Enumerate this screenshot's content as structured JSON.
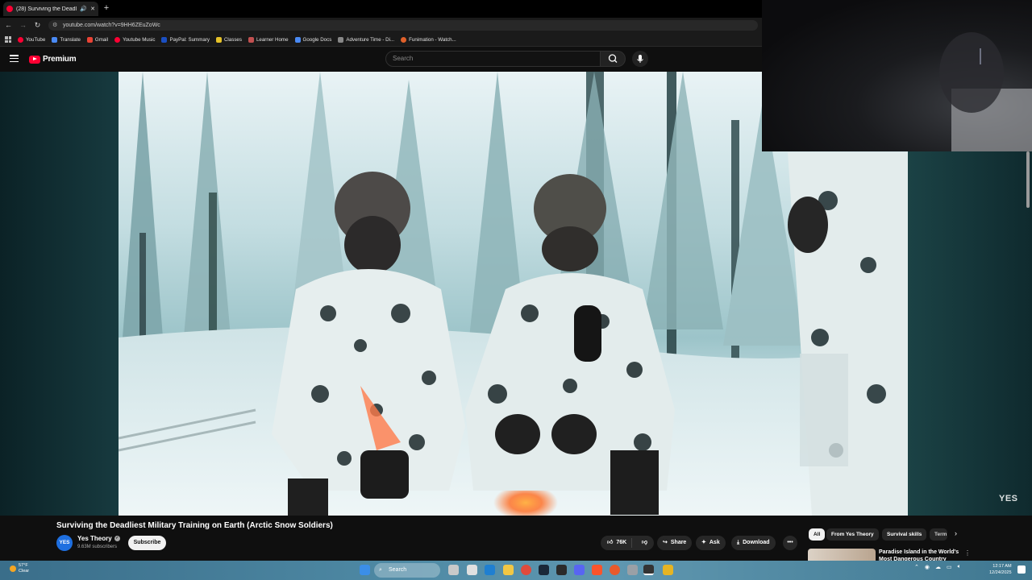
{
  "browser": {
    "tab_title": "(28) Surviving the Deadliest",
    "url": "youtube.com/watch?v=9HH6ZEuZoWc",
    "bookmarks": [
      {
        "label": "YouTube",
        "color": "#ff0033"
      },
      {
        "label": "Translate",
        "color": "#4a8af4"
      },
      {
        "label": "Gmail",
        "color": "#ea4335"
      },
      {
        "label": "Youtube Music",
        "color": "#ff0033"
      },
      {
        "label": "PayPal: Summary",
        "color": "#1b4fc2"
      },
      {
        "label": "Classes",
        "color": "#e6c229"
      },
      {
        "label": "Learner Home",
        "color": "#c25050"
      },
      {
        "label": "Google Docs",
        "color": "#4a8af4"
      },
      {
        "label": "Adventure Time - Di...",
        "color": "#888888"
      },
      {
        "label": "Funimation - Watch...",
        "color": "#e0602a"
      }
    ]
  },
  "youtube": {
    "brand": "Premium",
    "search_placeholder": "Search",
    "watermark": "YES",
    "video": {
      "title": "Surviving the Deadliest Military Training on Earth (Arctic Snow Soldiers)",
      "channel": "Yes Theory",
      "channel_avatar": "YES",
      "subscribers": "9.63M subscribers",
      "subscribe_label": "Subscribe",
      "likes": "76K",
      "share_label": "Share",
      "ask_label": "Ask",
      "download_label": "Download"
    },
    "chips": [
      "All",
      "From Yes Theory",
      "Survival skills",
      "Term"
    ],
    "recommendation": {
      "title": "Paradise Island in the World's Most Dangerous Country"
    }
  },
  "taskbar": {
    "weather_temp": "57°F",
    "weather_desc": "Clear",
    "search_label": "Search",
    "time": "12:17 AM",
    "date": "12/24/2025"
  },
  "colors": {
    "accent": "#ff0033",
    "background": "#0f0f0f"
  }
}
